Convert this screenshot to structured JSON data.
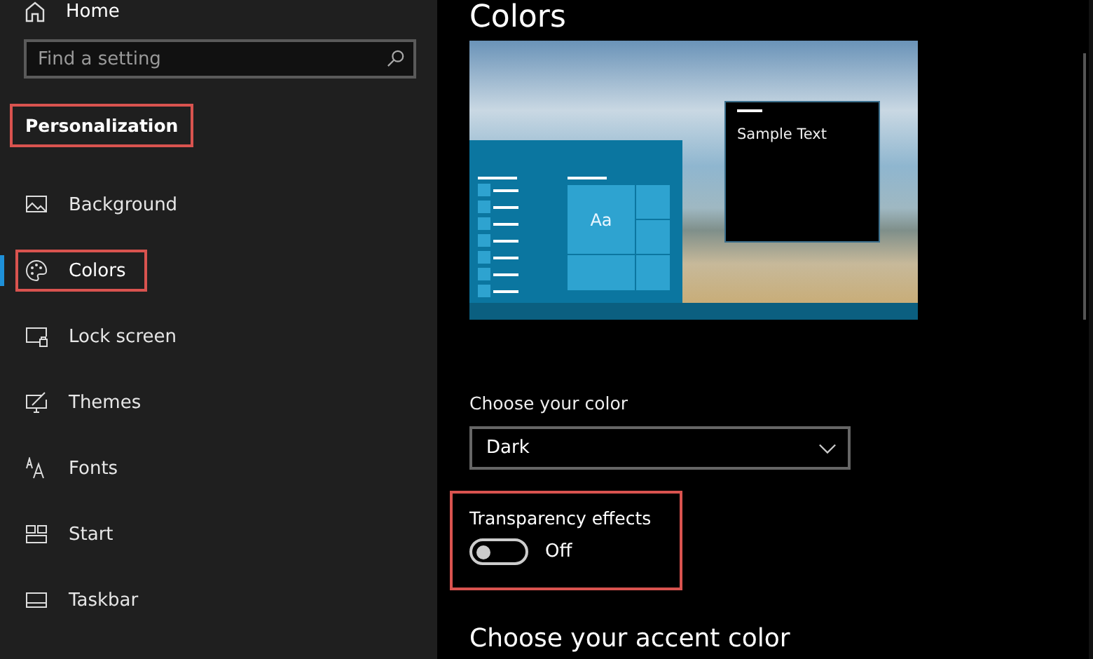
{
  "sidebar": {
    "home": {
      "label": "Home"
    },
    "search": {
      "placeholder": "Find a setting"
    },
    "section": {
      "label": "Personalization",
      "highlighted": true
    },
    "items": [
      {
        "label": "Background",
        "selected": false,
        "highlighted": false
      },
      {
        "label": "Colors",
        "selected": true,
        "highlighted": true
      },
      {
        "label": "Lock screen",
        "selected": false,
        "highlighted": false
      },
      {
        "label": "Themes",
        "selected": false,
        "highlighted": false
      },
      {
        "label": "Fonts",
        "selected": false,
        "highlighted": false
      },
      {
        "label": "Start",
        "selected": false,
        "highlighted": false
      },
      {
        "label": "Taskbar",
        "selected": false,
        "highlighted": false
      }
    ]
  },
  "main": {
    "title": "Colors",
    "preview": {
      "sample_text": "Sample Text",
      "tile_text": "Aa"
    },
    "color_choice": {
      "label": "Choose your color",
      "value": "Dark"
    },
    "transparency": {
      "label": "Transparency effects",
      "on": false,
      "state_text": "Off",
      "highlighted": true
    },
    "accent_heading": "Choose your accent color"
  }
}
